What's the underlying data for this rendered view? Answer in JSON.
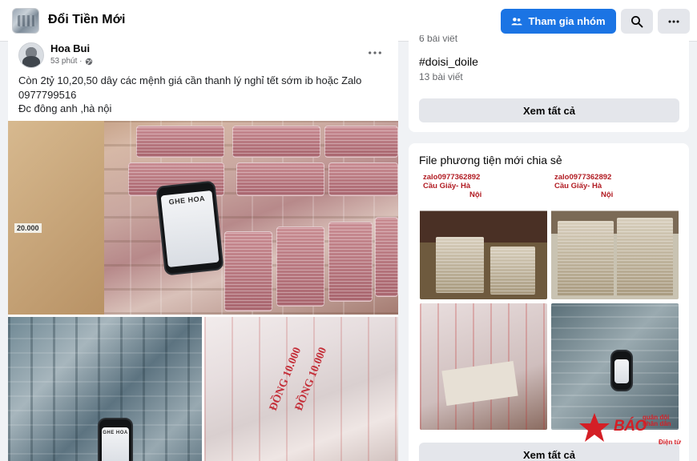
{
  "header": {
    "group_name": "Đổi Tiền Mới",
    "join_label": "Tham gia nhóm",
    "join_icon": "group-icon",
    "search_icon": "search-icon",
    "more_icon": "more-horizontal-icon"
  },
  "post": {
    "author": "Hoa Bui",
    "time": "53 phút ·",
    "visibility_icon": "globe-icon",
    "text_lines": [
      "Còn 2tỷ 10,20,50  dây các mệnh giá cần thanh lý nghỉ tết sớm ib hoặc Zalo",
      "0977799516",
      "Đc đông anh ,hà nội"
    ],
    "photos": {
      "main_phone_text": "GHE HOA",
      "main_label_20000": "20.000",
      "bottom_left_phone_text": "GHE HOA",
      "bottom_right_stamp_1": "ĐỒNG 10.000",
      "bottom_right_stamp_2": "ĐỒNG 10.000"
    }
  },
  "sidebar": {
    "topics": {
      "cut_count": "6 bài viết",
      "hashtag": "#doisi_doile",
      "hashtag_count": "13 bài viết",
      "see_all": "Xem tất cả"
    },
    "media": {
      "title": "File phương tiện mới chia sẻ",
      "thumbs": [
        {
          "line1": "zalo0977362892",
          "line2": "Cầu Giấy- Hà",
          "line3": "Nội"
        },
        {
          "line1": "zalo0977362892",
          "line2": "Cầu Giấy- Hà",
          "line3": "Nội"
        }
      ],
      "see_all": "Xem tất cả"
    }
  },
  "watermark": {
    "main": "BÁO",
    "sub_top": "quân đội nhân dân",
    "sub_bottom": "Điện tử"
  },
  "colors": {
    "primary": "#1b74e4",
    "background": "#f0f2f5",
    "card": "#ffffff",
    "secondary_button": "#e4e6eb",
    "watermark_red": "#d41f26"
  }
}
